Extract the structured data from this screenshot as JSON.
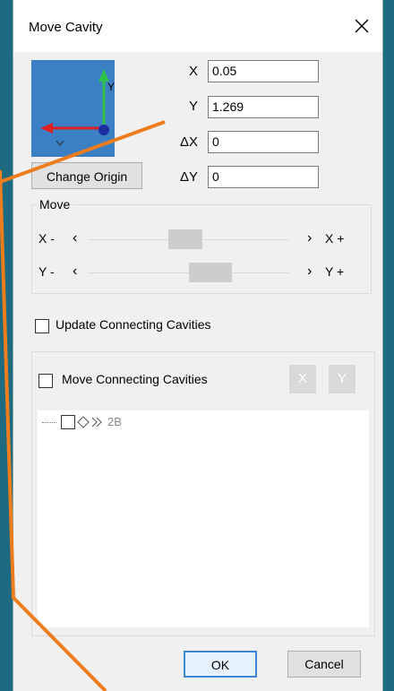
{
  "dialog": {
    "title": "Move Cavity",
    "origin_button": "Change Origin",
    "preview_axis_y": "Y"
  },
  "fields": {
    "x": {
      "label": "X",
      "value": "0.05"
    },
    "y": {
      "label": "Y",
      "value": "1.269"
    },
    "dx": {
      "label": "ΔX",
      "value": "0"
    },
    "dy": {
      "label": "ΔY",
      "value": "0"
    }
  },
  "move": {
    "title": "Move",
    "x_minus": "X -",
    "x_plus": "X +",
    "y_minus": "Y -",
    "y_plus": "Y +"
  },
  "options": {
    "update_connecting": "Update Connecting Cavities",
    "move_connecting": "Move Connecting Cavities",
    "x_button": "X",
    "y_button": "Y"
  },
  "tree": {
    "item_label": "2B"
  },
  "buttons": {
    "ok": "OK",
    "cancel": "Cancel"
  },
  "colors": {
    "background": "#1f6b82",
    "accent": "#ee7d1e",
    "preview": "#3b7fc4"
  }
}
